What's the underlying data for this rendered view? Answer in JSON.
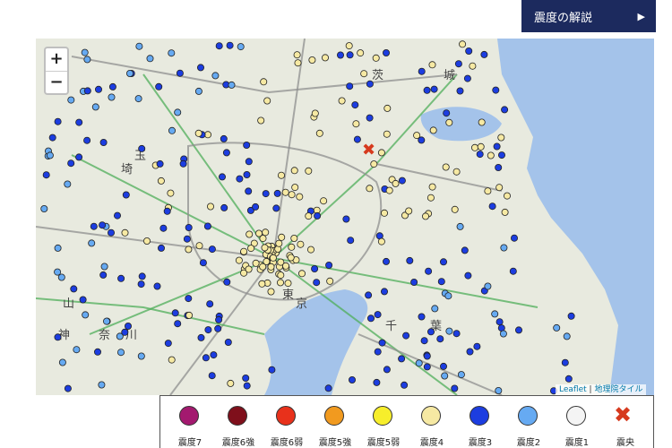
{
  "header": {
    "button_label": "震度の解説",
    "arrow": "▶"
  },
  "map": {
    "zoom_in": "+",
    "zoom_out": "−",
    "attribution": {
      "leaflet": "Leaflet",
      "separator": "|",
      "tiles": "地理院タイル"
    },
    "place_labels": [
      "茨",
      "城",
      "玉",
      "埼",
      "東",
      "京",
      "千",
      "葉",
      "神",
      "奈",
      "川",
      "山"
    ],
    "colors": {
      "land": "#e8eadf",
      "sea": "#a4c3ea",
      "road_green": "#4fae5a",
      "road_gray": "#8f8f8f"
    }
  },
  "legend": {
    "items": [
      {
        "label": "震度7",
        "color": "#a3196f"
      },
      {
        "label": "震度6強",
        "color": "#7f0f1b"
      },
      {
        "label": "震度6弱",
        "color": "#e8311b"
      },
      {
        "label": "震度5強",
        "color": "#f19a1f"
      },
      {
        "label": "震度5弱",
        "color": "#f7ee2b"
      },
      {
        "label": "震度4",
        "color": "#f6e9a3"
      },
      {
        "label": "震度3",
        "color": "#1c3de0"
      },
      {
        "label": "震度2",
        "color": "#66aaf2"
      },
      {
        "label": "震度1",
        "color": "#f4f4f4"
      },
      {
        "label": "震央",
        "symbol": "✖",
        "color": "#d63a1e"
      }
    ]
  }
}
